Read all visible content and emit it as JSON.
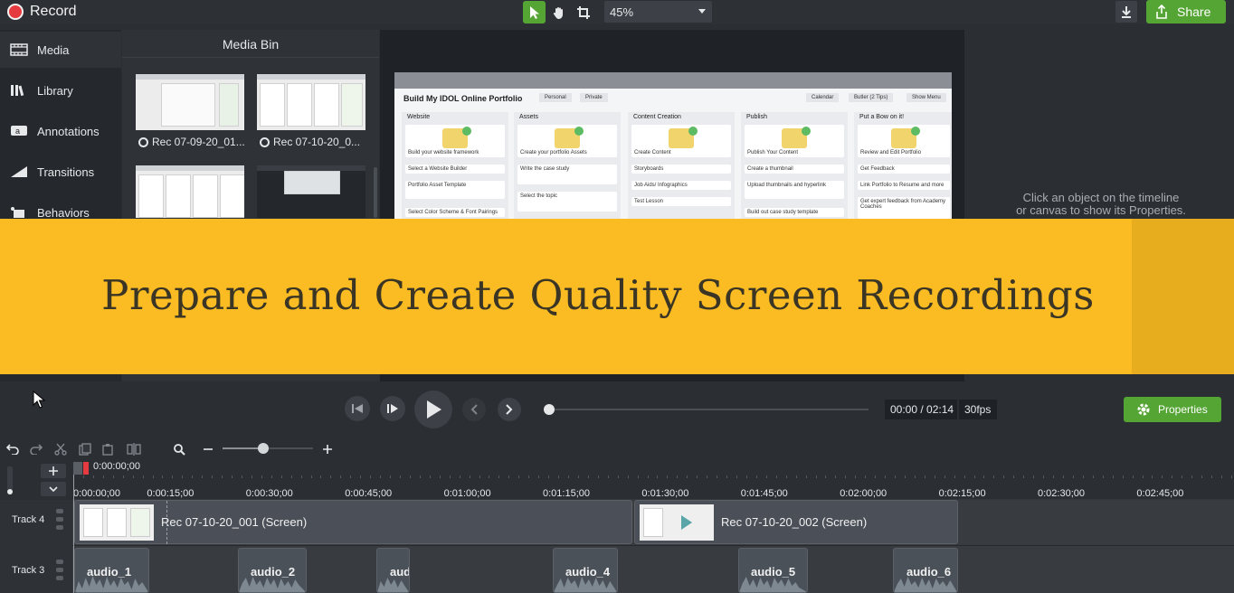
{
  "app": {
    "title": "Record"
  },
  "toolbar": {
    "zoom_value": "45%",
    "share_label": "Share",
    "icons": [
      "select-arrow-icon",
      "pan-hand-icon",
      "crop-icon",
      "download-icon",
      "share-icon"
    ]
  },
  "sidebar": {
    "items": [
      {
        "label": "Media",
        "icon": "film-icon"
      },
      {
        "label": "Library",
        "icon": "library-icon"
      },
      {
        "label": "Annotations",
        "icon": "annotation-icon"
      },
      {
        "label": "Transitions",
        "icon": "transition-icon"
      },
      {
        "label": "Behaviors",
        "icon": "behaviors-icon"
      }
    ]
  },
  "media_bin": {
    "title": "Media Bin",
    "items": [
      {
        "label": "Rec 07-09-20_01..."
      },
      {
        "label": "Rec 07-10-20_0..."
      }
    ]
  },
  "canvas": {
    "board_title": "Build My IDOL Online Portfolio",
    "top_pills": [
      "Personal",
      "Private"
    ],
    "right_pills": [
      "Calendar",
      "Butler (2 Tips)",
      "Show Menu"
    ],
    "columns": [
      {
        "title": "Website",
        "cards": [
          "Build your website framework",
          "Select a Website Builder",
          "Portfolio Asset Template",
          "Select Color Scheme & Font Pairings"
        ]
      },
      {
        "title": "Assets",
        "cards": [
          "Create your portfolio Assets",
          "Write the case study",
          "Select the topic"
        ]
      },
      {
        "title": "Content Creation",
        "cards": [
          "Create Content",
          "Storyboards",
          "Job Aids/ Infographics",
          "Test Lesson"
        ]
      },
      {
        "title": "Publish",
        "cards": [
          "Publish Your Content",
          "Create a thumbnail",
          "Upload thumbnails and hyperlink",
          "Build out case study template"
        ]
      },
      {
        "title": "Put a Bow on it!",
        "cards": [
          "Review and Edit Portfolio",
          "Get Feedback",
          "Link Portfolio to Resume and more",
          "Get expert feedback from Academy Coaches"
        ]
      }
    ]
  },
  "properties": {
    "hint_line1": "Click an object on the timeline",
    "hint_line2": "or canvas to show its Properties.",
    "button_label": "Properties"
  },
  "banner": {
    "text": "Prepare and Create Quality Screen Recordings"
  },
  "playback": {
    "timecode": "00:00 / 02:14",
    "fps": "30fps",
    "progress": 0
  },
  "timeline": {
    "playhead_time": "0:00:00;00",
    "ticks": [
      "0:00:00;00",
      "0:00:15;00",
      "0:00:30;00",
      "0:00:45;00",
      "0:01:00;00",
      "0:01:15;00",
      "0:01:30;00",
      "0:01:45;00",
      "0:02:00;00",
      "0:02:15;00",
      "0:02:30;00",
      "0:02:45;00"
    ],
    "tracks": [
      {
        "name": "Track 4",
        "clips": [
          {
            "label": "Rec 07-10-20_001 (Screen)"
          },
          {
            "label": "Rec 07-10-20_002 (Screen)"
          }
        ]
      },
      {
        "name": "Track 3",
        "clips": [
          {
            "label": "audio_1"
          },
          {
            "label": "audio_2"
          },
          {
            "label": "aud"
          },
          {
            "label": "audio_4"
          },
          {
            "label": "audio_5"
          },
          {
            "label": "audio_6"
          }
        ]
      }
    ]
  },
  "colors": {
    "accent_green": "#54a533",
    "record_red": "#e53a40",
    "banner_yellow": "#fbbc23",
    "banner_text": "#3a3524"
  }
}
